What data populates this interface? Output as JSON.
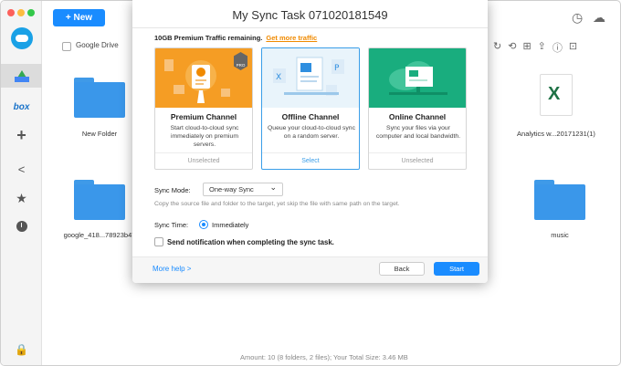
{
  "app": {
    "new_button": "+ New",
    "breadcrumb_label": "Google Drive",
    "sidebar_box_label": "box",
    "files": [
      {
        "name": "New Folder"
      },
      {
        "name": "Analytics w...20171231(1)"
      },
      {
        "name": "google_418...78923b47"
      },
      {
        "name": "music"
      }
    ],
    "status_bar": "Amount: 10 (8 folders, 2 files); Your Total Size: 3.46 MB"
  },
  "modal": {
    "title": "My Sync Task 071020181549",
    "premium_note": "10GB Premium Traffic remaining.",
    "premium_link": "Get more traffic",
    "cards": [
      {
        "title": "Premium Channel",
        "desc": "Start cloud-to-cloud sync immediately on premium servers.",
        "state": "Unselected",
        "badge": "PRO"
      },
      {
        "title": "Offline Channel",
        "desc": "Queue your cloud-to-cloud sync on a random server.",
        "state": "Select"
      },
      {
        "title": "Online Channel",
        "desc": "Sync your files via your computer and local bandwidth.",
        "state": "Unselected"
      }
    ],
    "sync_mode_label": "Sync Mode:",
    "sync_mode_value": "One-way Sync",
    "sync_mode_hint": "Copy the source file and folder to the target, yet skip the file with same path on the target.",
    "sync_time_label": "Sync Time:",
    "sync_time_value": "Immediately",
    "notify_label": "Send notification when completing the sync task.",
    "more_help": "More help >",
    "back_button": "Back",
    "start_button": "Start"
  },
  "colors": {
    "accent": "#1a8cff",
    "premium_orange": "#f59d24",
    "online_green": "#19ad7e",
    "link_orange": "#f08a00"
  }
}
